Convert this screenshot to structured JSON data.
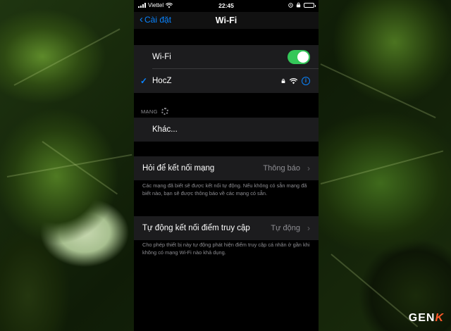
{
  "status_bar": {
    "carrier": "Viettel",
    "time": "22:45"
  },
  "nav": {
    "back_label": "Cài đặt",
    "title": "Wi-Fi"
  },
  "wifi_section": {
    "toggle_label": "Wi-Fi",
    "toggle_on": true,
    "connected_network": "HocZ",
    "info_symbol": "i"
  },
  "networks_section": {
    "header": "MẠNG",
    "other_label": "Khác..."
  },
  "ask_to_join": {
    "label": "Hỏi để kết nối mạng",
    "value": "Thông báo",
    "footer": "Các mạng đã biết sẽ được kết nối tự động. Nếu không có sẵn mạng đã biết nào, bạn sẽ được thông báo về các mạng có sẵn."
  },
  "auto_join_hotspot": {
    "label": "Tự động kết nối điểm truy cập",
    "value": "Tự động",
    "footer": "Cho phép thiết bị này tự động phát hiện điểm truy cập cá nhân ở gần khi không có mạng Wi-Fi nào khả dụng."
  },
  "watermark": {
    "text_main": "GEN",
    "text_k": "K"
  },
  "colors": {
    "accent": "#0a84ff",
    "toggle_on": "#34c759",
    "group_bg": "#1c1c1e",
    "secondary_text": "#8e8e93"
  },
  "icons": [
    "signal-icon",
    "wifi-icon",
    "alarm-icon",
    "lock-icon",
    "battery-icon",
    "chevron-left-icon",
    "checkmark-icon",
    "info-icon",
    "chevron-right-icon",
    "spinner-icon"
  ]
}
